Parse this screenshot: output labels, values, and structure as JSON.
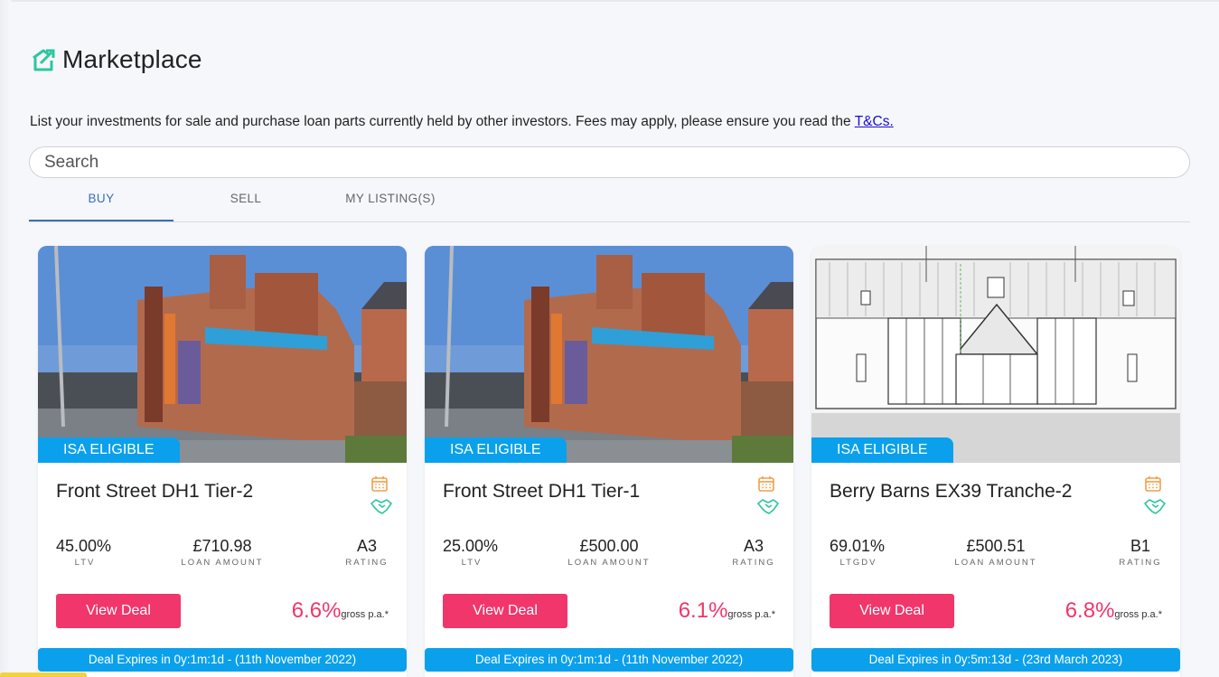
{
  "page": {
    "title": "Marketplace",
    "logo_icon": "house-chart-icon",
    "accent_color": "#2dc6a0",
    "intro_text": "List your investments for sale and purchase loan parts currently held by other investors. Fees may apply, please ensure you read the ",
    "intro_link": "T&Cs."
  },
  "search": {
    "placeholder": "Search",
    "value": ""
  },
  "tabs": [
    {
      "label": "BUY",
      "active": true
    },
    {
      "label": "SELL",
      "active": false
    },
    {
      "label": "MY LISTING(S)",
      "active": false
    }
  ],
  "colors": {
    "brand_blue": "#0aa0ec",
    "cta_pink": "#f0366a",
    "tab_active": "#3b6fb6"
  },
  "cards": [
    {
      "badge": "ISA ELIGIBLE",
      "title": "Front Street DH1 Tier-2",
      "image": "brick-building-photo",
      "stats": [
        {
          "value": "45.00%",
          "label": "LTV"
        },
        {
          "value": "£710.98",
          "label": "LOAN AMOUNT"
        },
        {
          "value": "A3",
          "label": "RATING"
        }
      ],
      "button": "View Deal",
      "rate": "6.6%",
      "rate_suffix": "gross p.a.*",
      "expiry": "Deal Expires in 0y:1m:1d - (11th November 2022)"
    },
    {
      "badge": "ISA ELIGIBLE",
      "title": "Front Street DH1 Tier-1",
      "image": "brick-building-photo",
      "stats": [
        {
          "value": "25.00%",
          "label": "LTV"
        },
        {
          "value": "£500.00",
          "label": "LOAN AMOUNT"
        },
        {
          "value": "A3",
          "label": "RATING"
        }
      ],
      "button": "View Deal",
      "rate": "6.1%",
      "rate_suffix": "gross p.a.*",
      "expiry": "Deal Expires in 0y:1m:1d - (11th November 2022)"
    },
    {
      "badge": "ISA ELIGIBLE",
      "title": "Berry Barns EX39 Tranche-2",
      "image": "barn-elevation-drawing",
      "stats": [
        {
          "value": "69.01%",
          "label": "LTGDV"
        },
        {
          "value": "£500.51",
          "label": "LOAN AMOUNT"
        },
        {
          "value": "B1",
          "label": "RATING"
        }
      ],
      "button": "View Deal",
      "rate": "6.8%",
      "rate_suffix": "gross p.a.*",
      "expiry": "Deal Expires in 0y:5m:13d - (23rd March 2023)"
    }
  ]
}
